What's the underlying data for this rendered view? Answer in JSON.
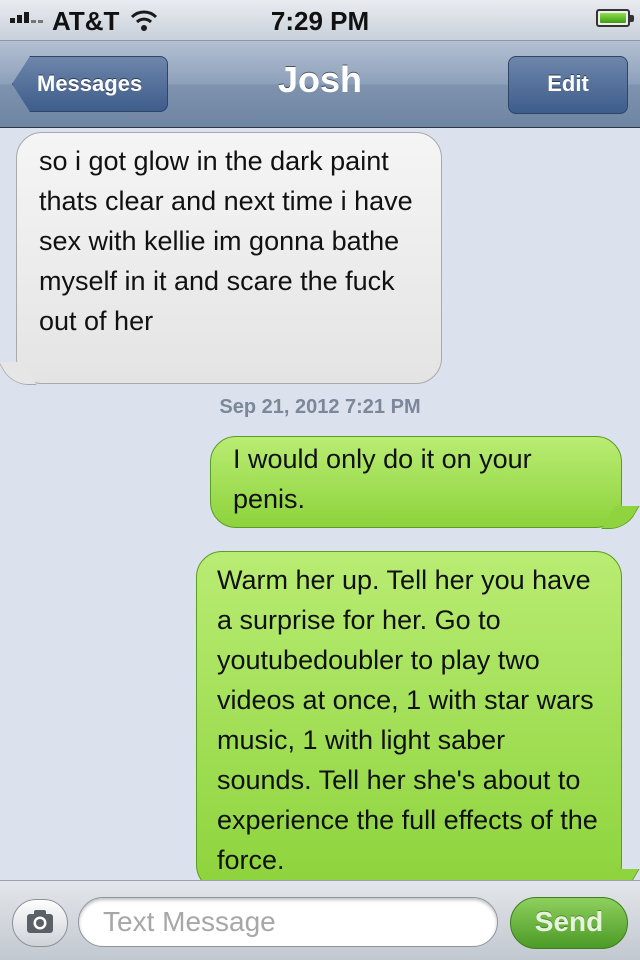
{
  "status_bar": {
    "carrier": "AT&T",
    "time": "7:29 PM",
    "signal_bars": 3,
    "battery_level": 1.0
  },
  "nav": {
    "back_label": "Messages",
    "title": "Josh",
    "edit_label": "Edit"
  },
  "messages": [
    {
      "direction": "incoming",
      "text": "so i got glow in the dark paint thats clear and next time i have sex with kellie im gonna bathe myself in it and scare the fuck out of her"
    },
    {
      "direction": "outgoing",
      "text": "I would only do it on your penis."
    },
    {
      "direction": "outgoing",
      "text": "Warm her up. Tell her you have a surprise for her. Go to youtubedoubler to play two videos at once, 1 with star wars music, 1 with light saber sounds. Tell her she's about to experience the full effects of the force."
    }
  ],
  "timestamp": "Sep 21, 2012 7:21 PM",
  "composer": {
    "placeholder": "Text Message",
    "send_label": "Send",
    "camera_icon": "camera-icon"
  },
  "colors": {
    "incoming_bubble": "#e8e8e8",
    "outgoing_bubble": "#a3e05a",
    "nav_bar": "#7d92ad",
    "background": "#dbe2ed",
    "send_button": "#5ea833"
  }
}
